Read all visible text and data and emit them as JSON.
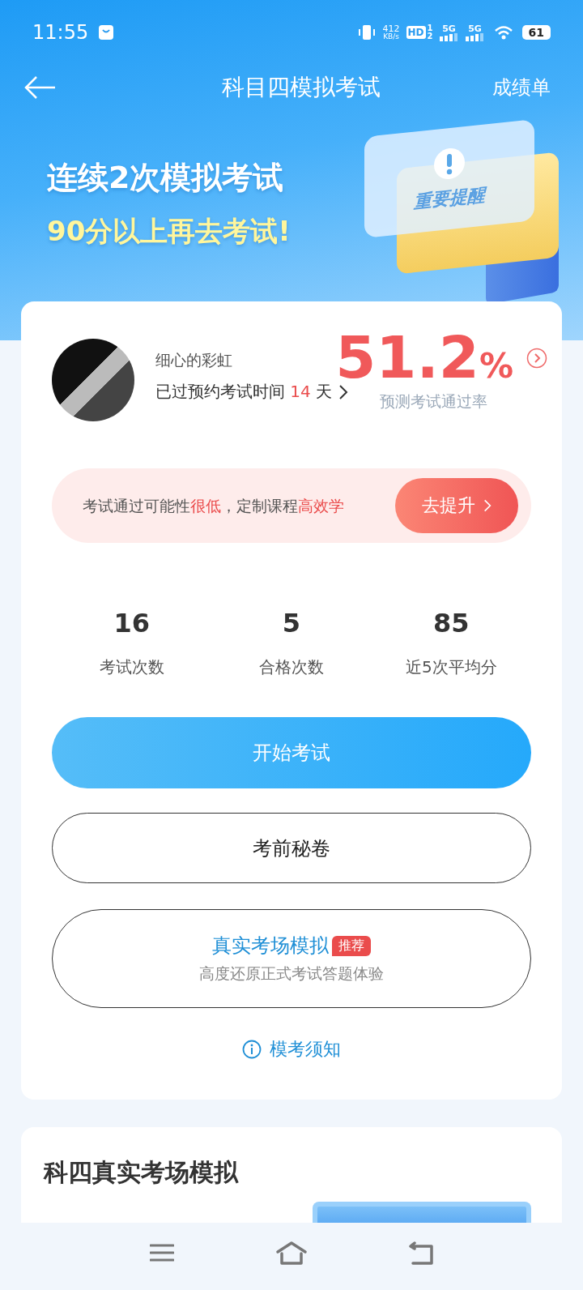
{
  "status_bar": {
    "time": "11:55",
    "net_speed": "412",
    "net_unit": "KB/s",
    "hd": "HD",
    "sim_labels": [
      "1",
      "2"
    ],
    "networks": [
      "5G",
      "5G"
    ],
    "battery": "61"
  },
  "header": {
    "title": "科目四模拟考试",
    "action": "成绩单"
  },
  "banner": {
    "line_1": "连续2次模拟考试",
    "line_2": "90分以上再去考试!",
    "badge": "重要提醒"
  },
  "profile": {
    "name": "细心的彩虹",
    "overdue": [
      {
        "text": "已过预约考试时间 ",
        "highlight": false
      },
      {
        "text": "14",
        "highlight": true
      },
      {
        "text": " 天",
        "highlight": false
      }
    ]
  },
  "pass_rate": {
    "value": "51.2",
    "unit": "%",
    "label": "预测考试通过率"
  },
  "advice": {
    "segments": [
      {
        "text": "考试通过可能性",
        "highlight": false
      },
      {
        "text": "很低",
        "highlight": true
      },
      {
        "text": "，定制课程",
        "highlight": false
      },
      {
        "text": "高效学",
        "highlight": true
      }
    ],
    "button": "去提升"
  },
  "stats": [
    {
      "value": "16",
      "label": "考试次数"
    },
    {
      "value": "5",
      "label": "合格次数"
    },
    {
      "value": "85",
      "label": "近5次平均分"
    }
  ],
  "actions": [
    {
      "kind": "primary",
      "label": "开始考试"
    },
    {
      "kind": "outline",
      "label": "考前秘卷"
    },
    {
      "kind": "feature",
      "label": "真实考场模拟",
      "tag": "推荐",
      "subtitle": "高度还原正式考试答题体验"
    }
  ],
  "notice_link": "模考须知",
  "section": {
    "title": "科四真实考场模拟"
  }
}
